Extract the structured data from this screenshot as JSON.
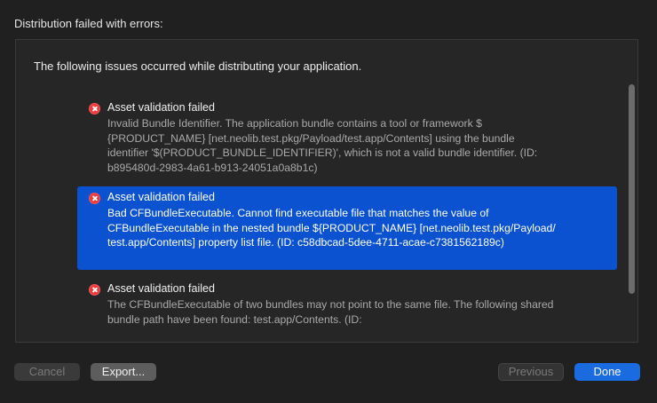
{
  "dialog": {
    "title": "Distribution failed with errors:"
  },
  "panel": {
    "intro": "The following issues occurred while distributing your application."
  },
  "issues": [
    {
      "title": "Asset validation failed",
      "body": "Invalid Bundle Identifier. The application bundle contains a tool or framework $\n{PRODUCT_NAME} [net.neolib.test.pkg/Payload/test.app/Contents] using the bundle\nidentifier '$(PRODUCT_BUNDLE_IDENTIFIER)', which is not a valid bundle identifier. (ID:\nb895480d-2983-4a61-b913-24051a0a8b1c)",
      "selected": false
    },
    {
      "title": "Asset validation failed",
      "body": "Bad CFBundleExecutable. Cannot find executable file that matches the value of\nCFBundleExecutable in the nested bundle ${PRODUCT_NAME} [net.neolib.test.pkg/Payload/\ntest.app/Contents] property list file. (ID: c58dbcad-5dee-4711-acae-c7381562189c)",
      "selected": true
    },
    {
      "title": "Asset validation failed",
      "body": "The CFBundleExecutable of two bundles may not point to the same file. The following shared\nbundle path have been found: test.app/Contents. (ID:",
      "selected": false
    }
  ],
  "buttons": {
    "cancel": "Cancel",
    "export": "Export...",
    "previous": "Previous",
    "done": "Done"
  },
  "colors": {
    "selection": "#0a52cf",
    "error_icon": "#ee3a3a",
    "primary_button": "#1a6ae0"
  },
  "icons": {
    "issue": "error-x-circle-icon"
  }
}
